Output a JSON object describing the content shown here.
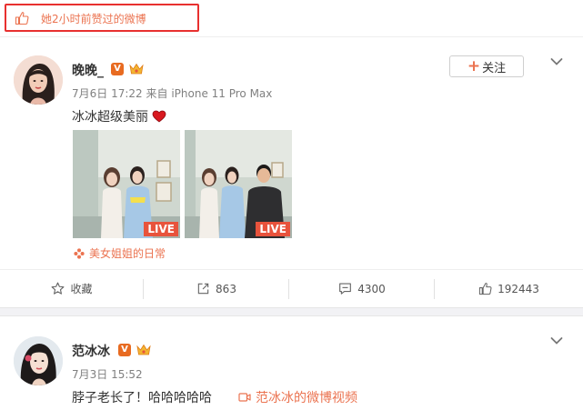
{
  "liked_notice": {
    "text": "她2小时前赞过的微博",
    "icon": "thumbs-up-icon"
  },
  "posts": [
    {
      "username": "晚晚_",
      "verified_badge": "V",
      "time": "7月6日 17:22",
      "source": "来自 iPhone 11 Pro Max",
      "text": "冰冰超级美丽",
      "follow_label": "关注",
      "images": [
        {
          "badge": "LIVE"
        },
        {
          "badge": "LIVE"
        }
      ],
      "topic": "美女姐姐的日常",
      "actions": {
        "favorite_label": "收藏",
        "repost_count": "863",
        "comment_count": "4300",
        "like_count": "192443"
      }
    },
    {
      "username": "范冰冰",
      "verified_badge": "V",
      "time": "7月3日 15:52",
      "text": "脖子老长了！哈哈哈哈哈",
      "video_link": "范冰冰的微博视频"
    }
  ],
  "colors": {
    "accent": "#eb7350",
    "highlight_border": "#e8302f",
    "live_badge": "#e8533c",
    "verified": "#e86b21"
  }
}
